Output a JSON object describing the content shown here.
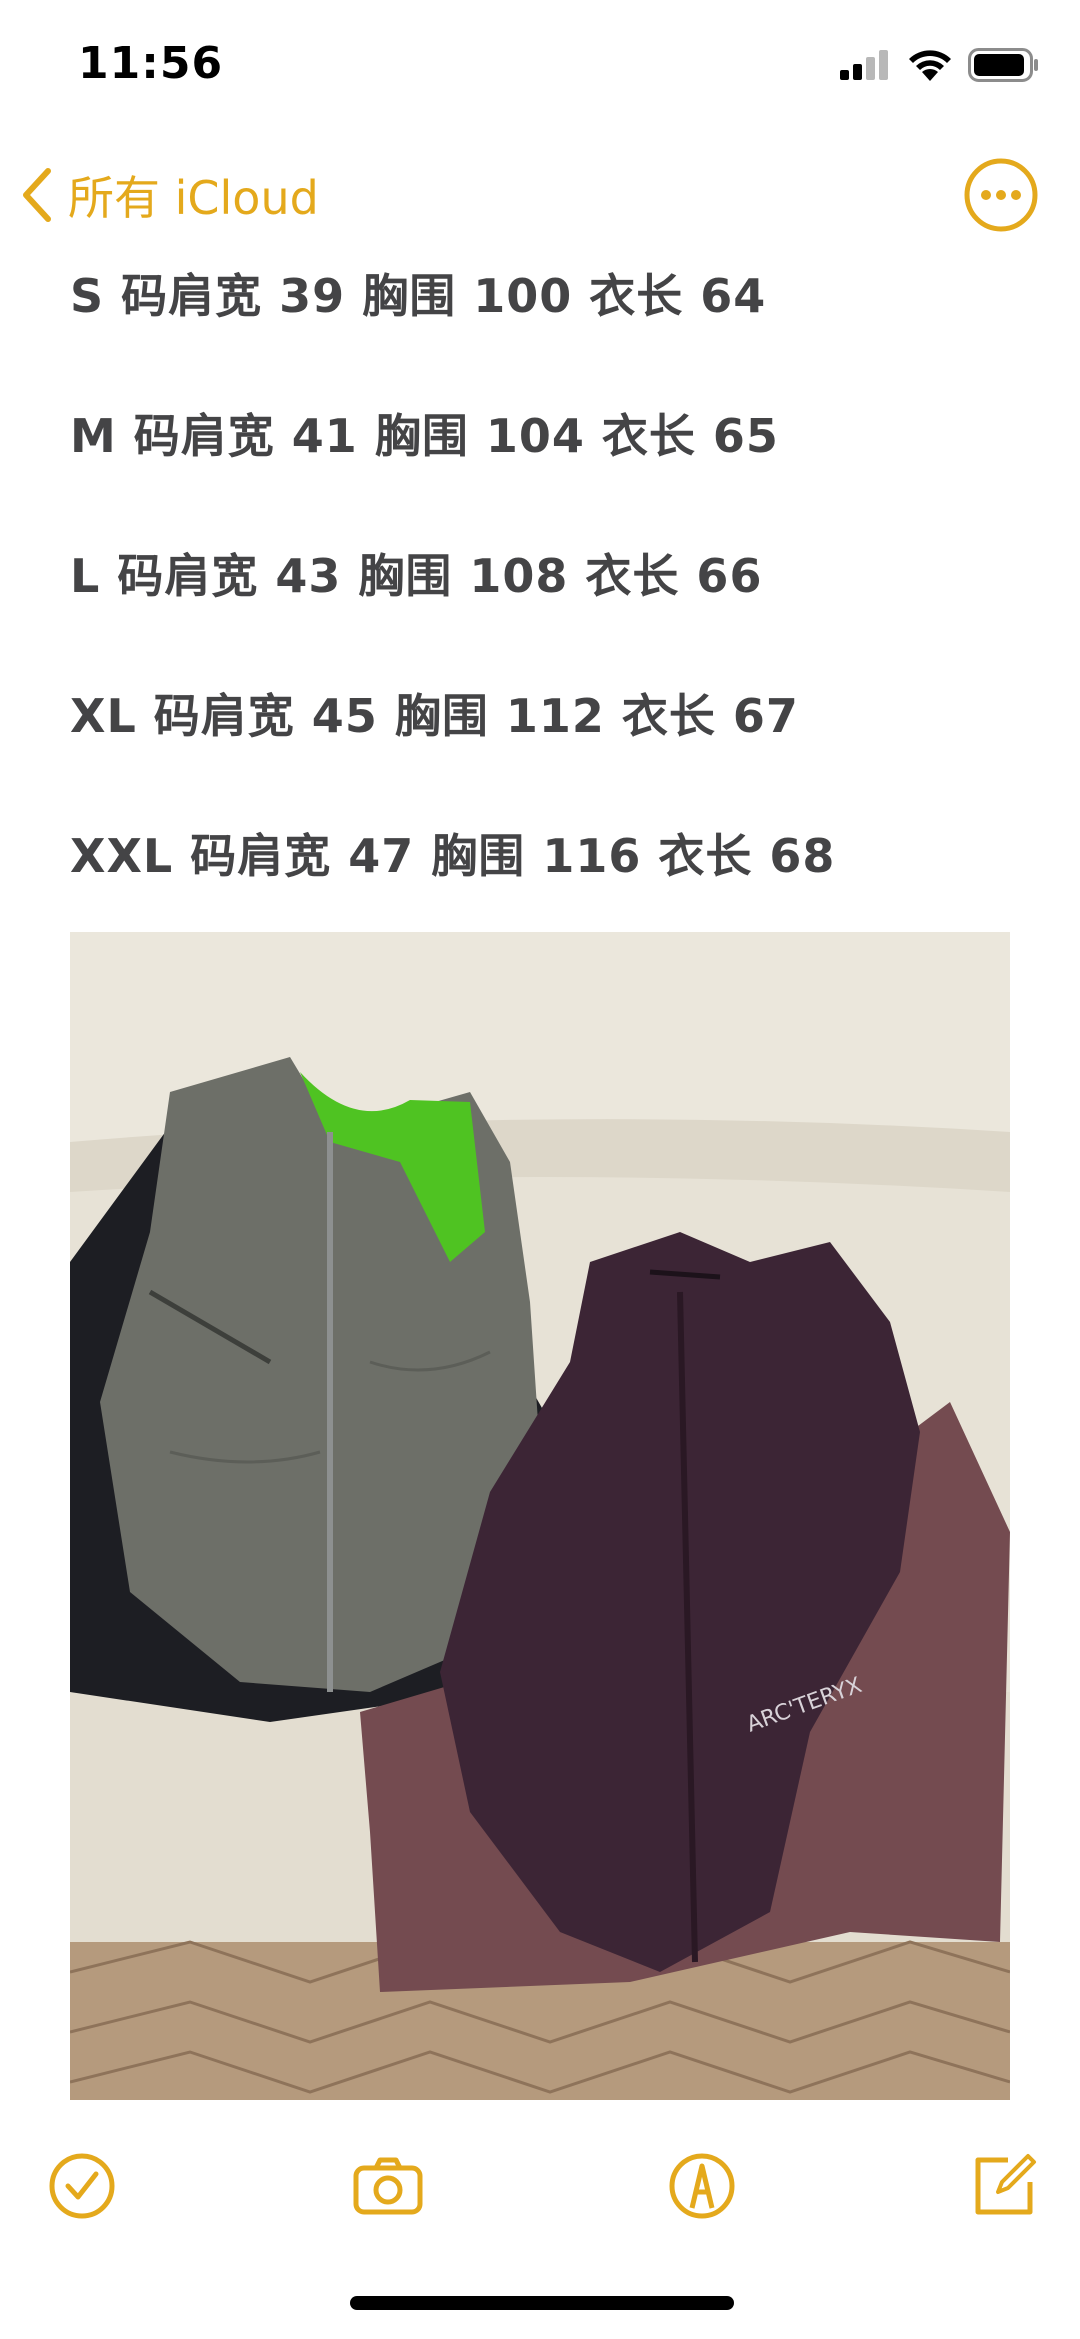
{
  "status_bar": {
    "time": "11:56"
  },
  "nav": {
    "back_label": "所有 iCloud",
    "accent_color": "#e4a91c"
  },
  "note": {
    "lines": [
      "S 码肩宽 39 胸围 100 衣长 64",
      "M 码肩宽 41 胸围 104 衣长 65",
      "L 码肩宽 43 胸围 108 衣长 66",
      "XL 码肩宽 45 胸围 112 衣长 67",
      "XXL 码肩宽 47 胸围 116 衣长 68"
    ]
  },
  "photo": {
    "brand_text": "ARC'TERYX"
  },
  "toolbar": {
    "icons": [
      "checklist-icon",
      "camera-icon",
      "markup-icon",
      "compose-icon"
    ]
  }
}
